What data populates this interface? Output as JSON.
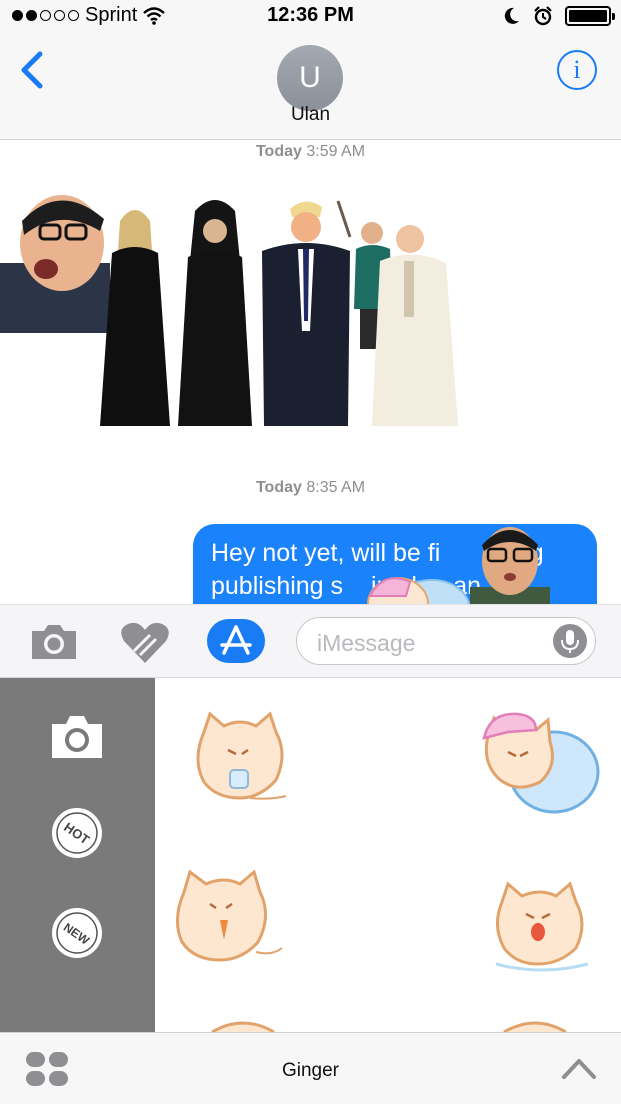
{
  "status_bar": {
    "carrier": "Sprint",
    "signal_bars_filled": 2,
    "signal_bars_total": 5,
    "time": "12:36 PM",
    "battery_level": 1.0,
    "icons": [
      "wifi-icon",
      "do-not-disturb-icon",
      "alarm-icon",
      "battery-icon"
    ]
  },
  "header": {
    "avatar_initial": "U",
    "contact_name": "Ulan",
    "back_icon": "chevron-left-icon",
    "info_icon": "info-icon",
    "info_glyph": "i"
  },
  "conversation": {
    "messages": [
      {
        "timestamp_day": "Today",
        "timestamp_time": "3:59 AM",
        "type": "sticker-photo"
      },
      {
        "timestamp_day": "Today",
        "timestamp_time": "8:35 AM",
        "type": "outgoing-text",
        "text_line_1": "Hey not yet, will be fi",
        "text_line_1_tail": "ing",
        "text_line_2": "publishing s",
        "text_line_2_mid": "in ab",
        "text_line_2_tail": "an"
      }
    ]
  },
  "compose": {
    "placeholder": "iMessage",
    "icons": [
      "camera-icon",
      "digital-touch-heart-icon",
      "app-store-icon",
      "microphone-icon"
    ]
  },
  "drawer": {
    "sidebar_icons": [
      "camera-icon",
      "hot-sticker-icon",
      "new-sticker-icon"
    ],
    "hot_label": "HOT",
    "new_label": "NEW"
  },
  "bottom_bar": {
    "app_name": "Ginger",
    "icons": [
      "app-grid-icon",
      "chevron-up-icon"
    ]
  },
  "colors": {
    "accent": "#1a7cf5",
    "bubble": "#1a82fb",
    "drawer_sidebar": "#7a7a7a"
  }
}
